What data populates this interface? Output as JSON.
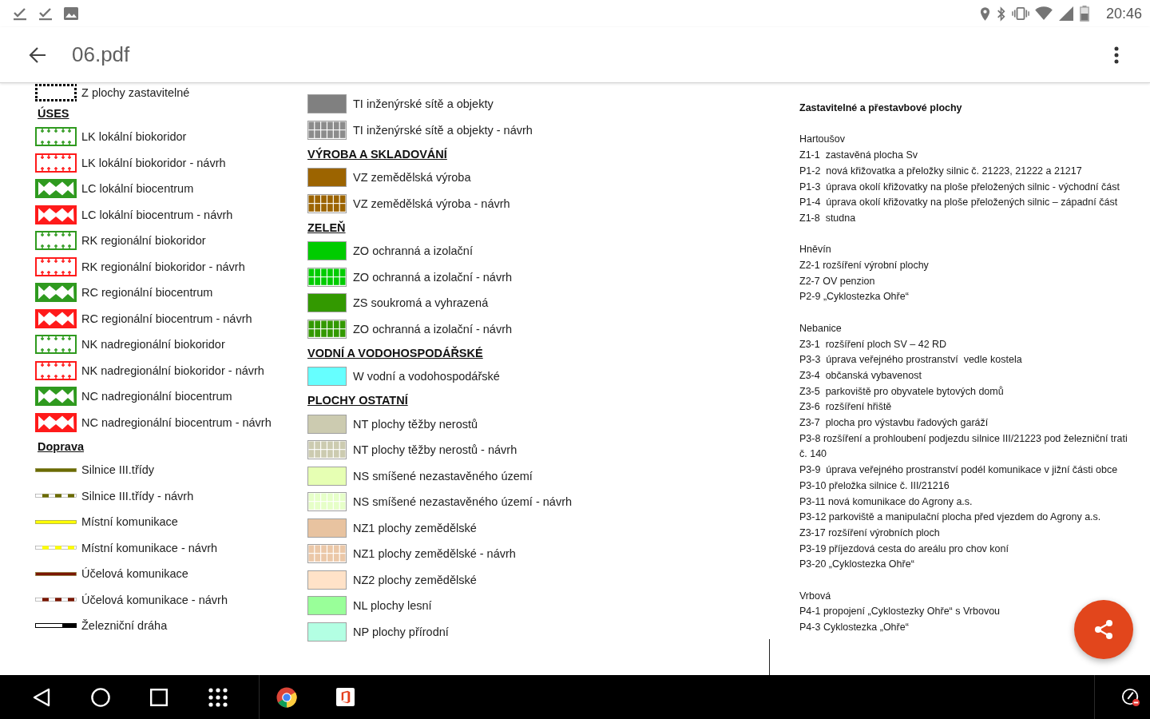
{
  "status_bar": {
    "time": "20:46"
  },
  "app_bar": {
    "title": "06.pdf"
  },
  "legend_columns": [
    {
      "sections": [
        {
          "items": [
            {
              "kind": "outline",
              "color": "#000000",
              "label": "Z plochy zastavitelné"
            }
          ]
        },
        {
          "heading": "ÚSES",
          "items": [
            {
              "kind": "corridor",
              "color": "#2f9a1f",
              "label": "LK lokální biokoridor"
            },
            {
              "kind": "corridor",
              "color": "#ff1a1a",
              "label": "LK lokální biokoridor - návrh"
            },
            {
              "kind": "center",
              "color": "#2f9a1f",
              "label": "LC lokální biocentrum"
            },
            {
              "kind": "center",
              "color": "#ff1a1a",
              "label": "LC lokální biocentrum - návrh"
            },
            {
              "kind": "corridor",
              "color": "#2f9a1f",
              "label": "RK regionální biokoridor"
            },
            {
              "kind": "corridor",
              "color": "#ff1a1a",
              "label": "RK regionální biokoridor - návrh"
            },
            {
              "kind": "center",
              "color": "#2f9a1f",
              "label": "RC regionální biocentrum"
            },
            {
              "kind": "center",
              "color": "#ff1a1a",
              "label": "RC regionální biocentrum - návrh"
            },
            {
              "kind": "corridor",
              "color": "#2f9a1f",
              "label": "NK nadregionální biokoridor"
            },
            {
              "kind": "corridor",
              "color": "#ff1a1a",
              "label": "NK nadregionální biokoridor - návrh"
            },
            {
              "kind": "center",
              "color": "#2f9a1f",
              "label": "NC nadregionální biocentrum"
            },
            {
              "kind": "center",
              "color": "#ff1a1a",
              "label": "NC nadregionální biocentrum - návrh"
            }
          ]
        },
        {
          "heading": "Doprava",
          "items": [
            {
              "kind": "line",
              "color": "#6b6b00",
              "label": "Silnice III.třídy"
            },
            {
              "kind": "dashed",
              "color": "#6b6b00",
              "label": "Silnice III.třídy - návrh"
            },
            {
              "kind": "line",
              "color": "#ffff00",
              "label": "Místní komunikace"
            },
            {
              "kind": "dashed",
              "color": "#ffff00",
              "label": "Místní komunikace - návrh"
            },
            {
              "kind": "line",
              "color": "#7a1600",
              "label": "Účelová komunikace"
            },
            {
              "kind": "dashed",
              "color": "#7a1600",
              "label": "Účelová komunikace - návrh"
            },
            {
              "kind": "rail",
              "color": "#000000",
              "label": "Železniční dráha"
            }
          ]
        }
      ]
    },
    {
      "sections": [
        {
          "items": [
            {
              "kind": "fill",
              "color": "#808080",
              "label": "TI inženýrské sítě a objekty"
            },
            {
              "kind": "grid",
              "color": "#8c8c8c",
              "label": "TI inženýrské sítě a objekty - návrh"
            }
          ]
        },
        {
          "heading": "VÝROBA A SKLADOVÁNÍ",
          "items": [
            {
              "kind": "fill",
              "color": "#9c6400",
              "label": "VZ zemědělská výroba"
            },
            {
              "kind": "grid",
              "color": "#9c6400",
              "label": "VZ zemědělská výroba - návrh"
            }
          ]
        },
        {
          "heading": "ZELEŇ",
          "items": [
            {
              "kind": "fill",
              "color": "#00cc00",
              "label": "ZO ochranná a izolační"
            },
            {
              "kind": "grid",
              "color": "#00cc00",
              "label": "ZO ochranná a izolační - návrh"
            },
            {
              "kind": "fill",
              "color": "#339900",
              "label": "ZS soukromá a vyhrazená"
            },
            {
              "kind": "grid",
              "color": "#339900",
              "label": "ZO ochranná a izolační - návrh"
            }
          ]
        },
        {
          "heading": "VODNÍ A VODOHOSPODÁŘSKÉ",
          "items": [
            {
              "kind": "fill",
              "color": "#66ffff",
              "label": "W vodní a vodohospodářské"
            }
          ]
        },
        {
          "heading": "PLOCHY OSTATNÍ",
          "items": [
            {
              "kind": "fill",
              "color": "#cccbb0",
              "label": "NT plochy těžby nerostů"
            },
            {
              "kind": "grid",
              "color": "#cccbb0",
              "label": "NT plochy těžby nerostů - návrh"
            },
            {
              "kind": "fill",
              "color": "#e6ffb3",
              "label": "NS smíšené nezastavěného území"
            },
            {
              "kind": "grid",
              "color": "#e6ffc8",
              "label": "NS smíšené nezastavěného území - návrh"
            },
            {
              "kind": "fill",
              "color": "#e8c3a0",
              "label": "NZ1 plochy zemědělské"
            },
            {
              "kind": "grid",
              "color": "#ebc8a8",
              "label": "NZ1 plochy zemědělské - návrh"
            },
            {
              "kind": "fill",
              "color": "#ffe2c8",
              "label": "NZ2 plochy zemědělské"
            },
            {
              "kind": "fill",
              "color": "#99ff99",
              "label": "NL plochy lesní"
            },
            {
              "kind": "fill",
              "color": "#b3ffe3",
              "label": "NP plochy přírodní"
            }
          ]
        }
      ]
    }
  ],
  "areas": {
    "title": "Zastavitelné a přestavbové plochy",
    "groups": [
      {
        "name": "Hartoušov",
        "lines": [
          "Z1-1  zastavěná plocha Sv",
          "P1-2  nová křižovatka a přeložky silnic č. 21223, 21222 a 21217",
          "P1-3  úprava okolí křižovatky na ploše přeložených silnic - východní část",
          "P1-4  úprava okolí křižovatky na ploše přeložených silnic – západní část",
          "Z1-8  studna"
        ]
      },
      {
        "name": "Hněvín",
        "lines": [
          "Z2-1 rozšíření výrobní plochy",
          "Z2-7 OV penzion",
          "P2-9 „Cyklostezka Ohře“"
        ]
      },
      {
        "name": "Nebanice",
        "lines": [
          "Z3-1  rozšíření ploch SV – 42 RD",
          "P3-3  úprava veřejného prostranství  vedle kostela",
          "Z3-4  občanská vybavenost",
          "Z3-5  parkoviště pro obyvatele bytových domů",
          "Z3-6  rozšíření hřiště",
          "Z3-7  plocha pro výstavbu řadových garáží",
          "P3-8 rozšíření a prohloubení podjezdu silnice III/21223 pod železniční trati\nč. 140",
          "P3-9  úprava veřejného prostranství podél komunikace v jižní části obce",
          "P3-10 přeložka silnice č. III/21216",
          "P3-11 nová komunikace do Agrony a.s.",
          "P3-12 parkoviště a manipulační plocha před vjezdem do Agrony a.s.",
          "Z3-17 rozšíření výrobních ploch",
          "P3-19 příjezdová cesta do areálu pro chov koní",
          "P3-20 „Cyklostezka Ohře“"
        ]
      },
      {
        "name": "Vrbová",
        "lines": [
          "P4-1 propojení „Cyklostezky Ohře“ s Vrbovou",
          "P4-3 Cyklostezka „Ohře“"
        ]
      }
    ]
  }
}
